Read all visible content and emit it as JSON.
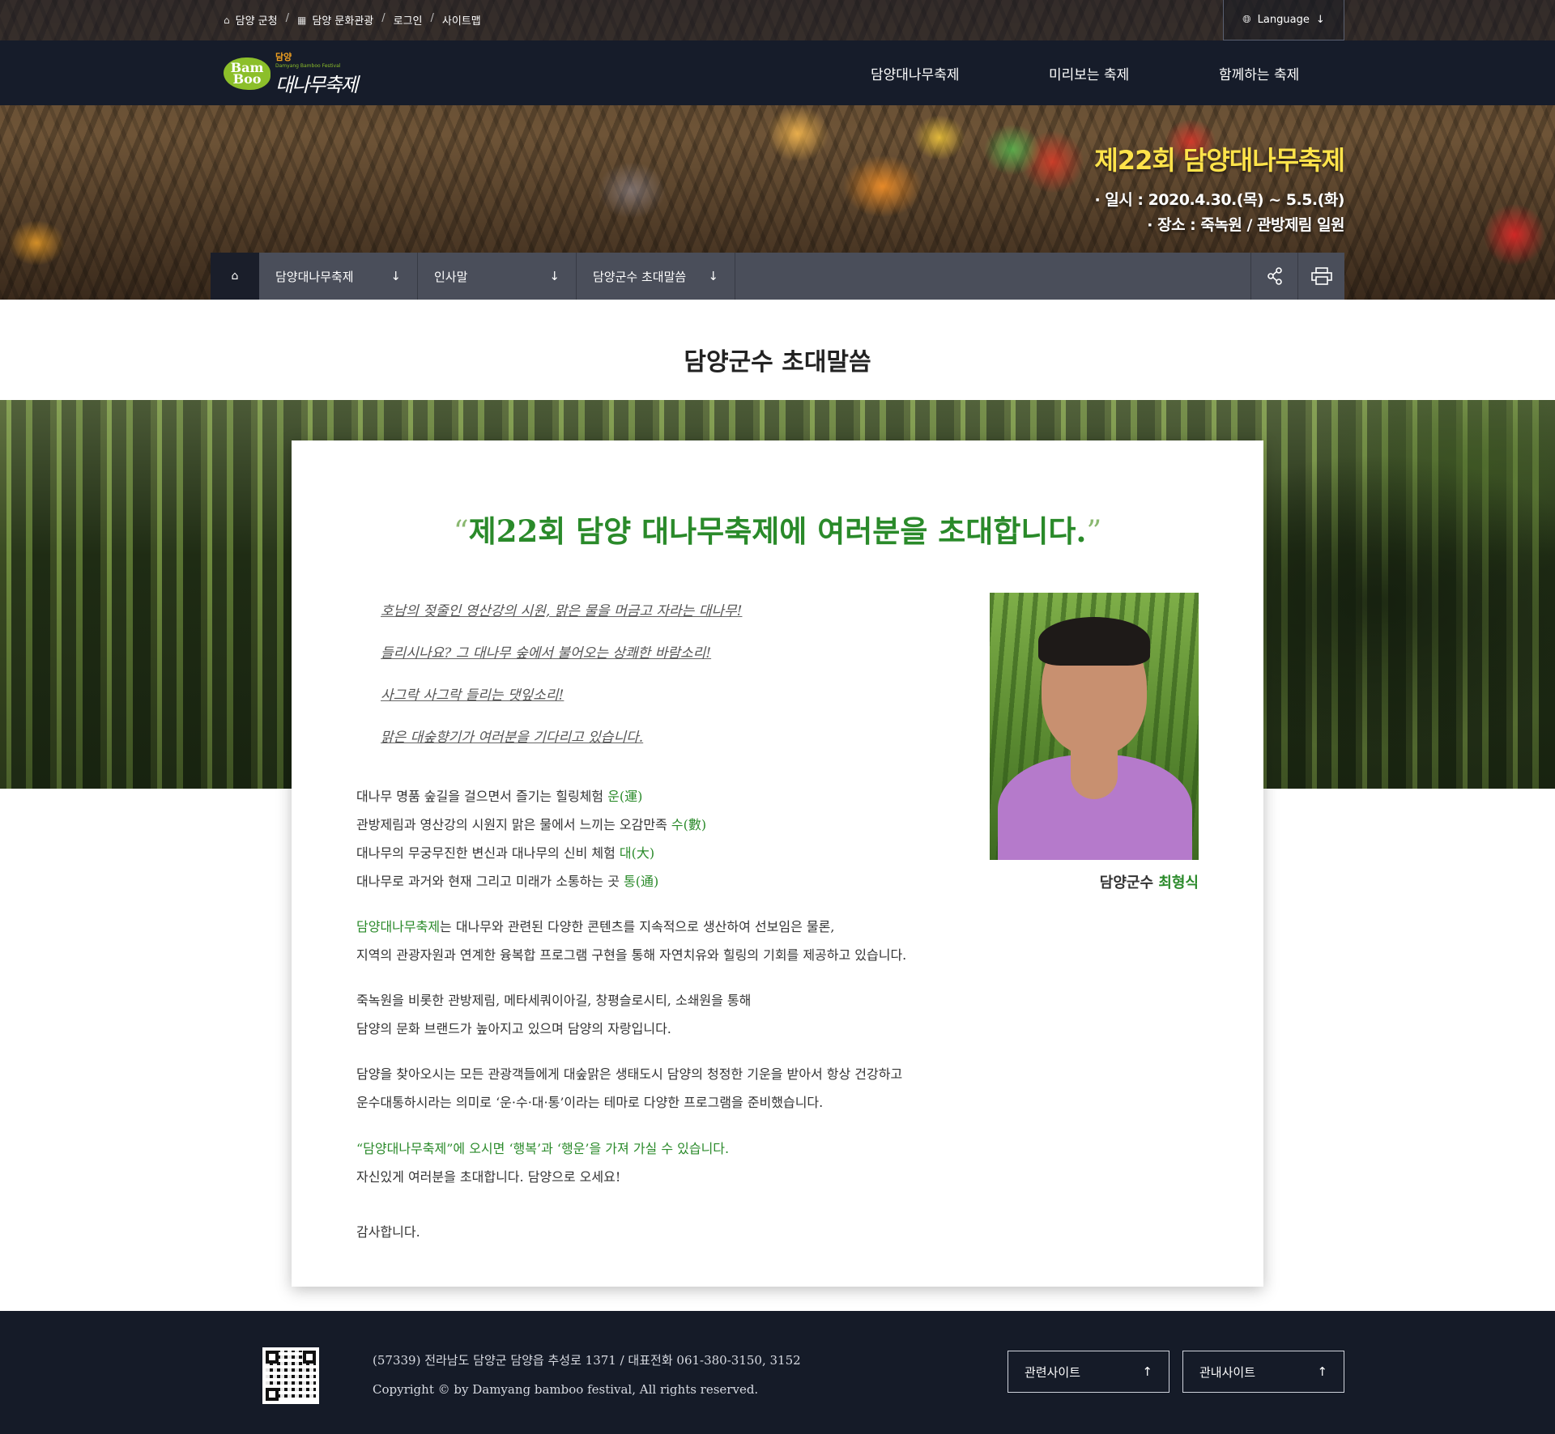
{
  "util": {
    "links": [
      {
        "icon": "home-icon",
        "label": "담양 군청"
      },
      {
        "icon": "building-icon",
        "label": "담양 문화관광"
      },
      {
        "icon": "",
        "label": "로그인"
      },
      {
        "icon": "",
        "label": "사이트맵"
      }
    ],
    "language_label": "Language"
  },
  "logo": {
    "badge": "Bam Boo",
    "small": "담양",
    "tiny": "Damyang Bamboo Festival",
    "main": "대나무축제"
  },
  "gnb": [
    "담양대나무축제",
    "미리보는 축제",
    "함께하는 축제"
  ],
  "hero": {
    "title": "제22회 담양대나무축제",
    "date": "· 일시 : 2020.4.30.(목) ~ 5.5.(화)",
    "place": "· 장소 : 죽녹원 / 관방제림 일원"
  },
  "breadcrumb": {
    "items": [
      "담양대나무축제",
      "인사말",
      "담양군수 초대말씀"
    ],
    "arrow": "↓"
  },
  "page_title": "담양군수 초대말씀",
  "card": {
    "headline_open": "“",
    "headline": "제22회 담양 대나무축제에 여러분을 초대합니다.",
    "headline_close": "”",
    "poem": [
      "호남의 젖줄인 영산강의 시원, 맑은 물을 머금고 자라는 대나무!",
      "들리시나요? 그 대나무 숲에서 불어오는 상쾌한 바람소리!",
      "사그락 사그락 들리는 댓잎소리!",
      "맑은 대숲향기가 여러분을 기다리고 있습니다."
    ],
    "caption_title": "담양군수",
    "caption_name": "최형식",
    "luck_lines": [
      {
        "text": "대나무 명품 숲길을 걸으면서 즐기는 힐링체험 ",
        "hl": "운(運)"
      },
      {
        "text": "관방제림과 영산강의 시원지 맑은 물에서 느끼는 오감만족 ",
        "hl": "수(數)"
      },
      {
        "text": "대나무의 무궁무진한 변신과 대나무의 신비 체험 ",
        "hl": "대(大)"
      },
      {
        "text": "대나무로 과거와 현재 그리고 미래가 소통하는 곳 ",
        "hl": "통(通)"
      }
    ],
    "p2_hl": "담양대나무축제",
    "p2_line1": "는 대나무와 관련된 다양한 콘텐츠를 지속적으로 생산하여 선보임은 물론,",
    "p2_line2": "지역의 관광자원과 연계한 융복합 프로그램 구현을 통해 자연치유와 힐링의 기회를 제공하고 있습니다.",
    "p3_line1": "죽녹원을 비롯한 관방제림, 메타세쿼이아길, 창평슬로시티, 소쇄원을 통해",
    "p3_line2": "담양의 문화 브랜드가 높아지고 있으며 담양의 자랑입니다.",
    "p4_line1": "담양을 찾아오시는 모든 관광객들에게 대숲맑은 생태도시 담양의 청정한 기운을 받아서 항상 건강하고",
    "p4_line2": "운수대통하시라는 의미로 ‘운·수·대·통’이라는 테마로 다양한 프로그램을 준비했습니다.",
    "p5_line1": "“담양대나무축제”에 오시면 ‘행복’과 ‘행운’을 가져 가실 수 있습니다.",
    "p5_line2": "자신있게 여러분을 초대합니다. 담양으로 오세요!",
    "thanks": "감사합니다."
  },
  "footer": {
    "address": "(57339) 전라남도 담양군 담양읍 추성로 1371  / 대표전화 061-380-3150, 3152",
    "copyright": "Copyright © by Damyang bamboo festival, All rights reserved.",
    "btn_related": "관련사이트",
    "btn_guide": "관내사이트",
    "btn_arrow": "↑"
  },
  "colors": {
    "accent_green": "#2a8a2a",
    "hero_yellow": "#ffe34a",
    "nav_dark": "#161c2a",
    "crumb_gray": "#4a4e5a"
  }
}
